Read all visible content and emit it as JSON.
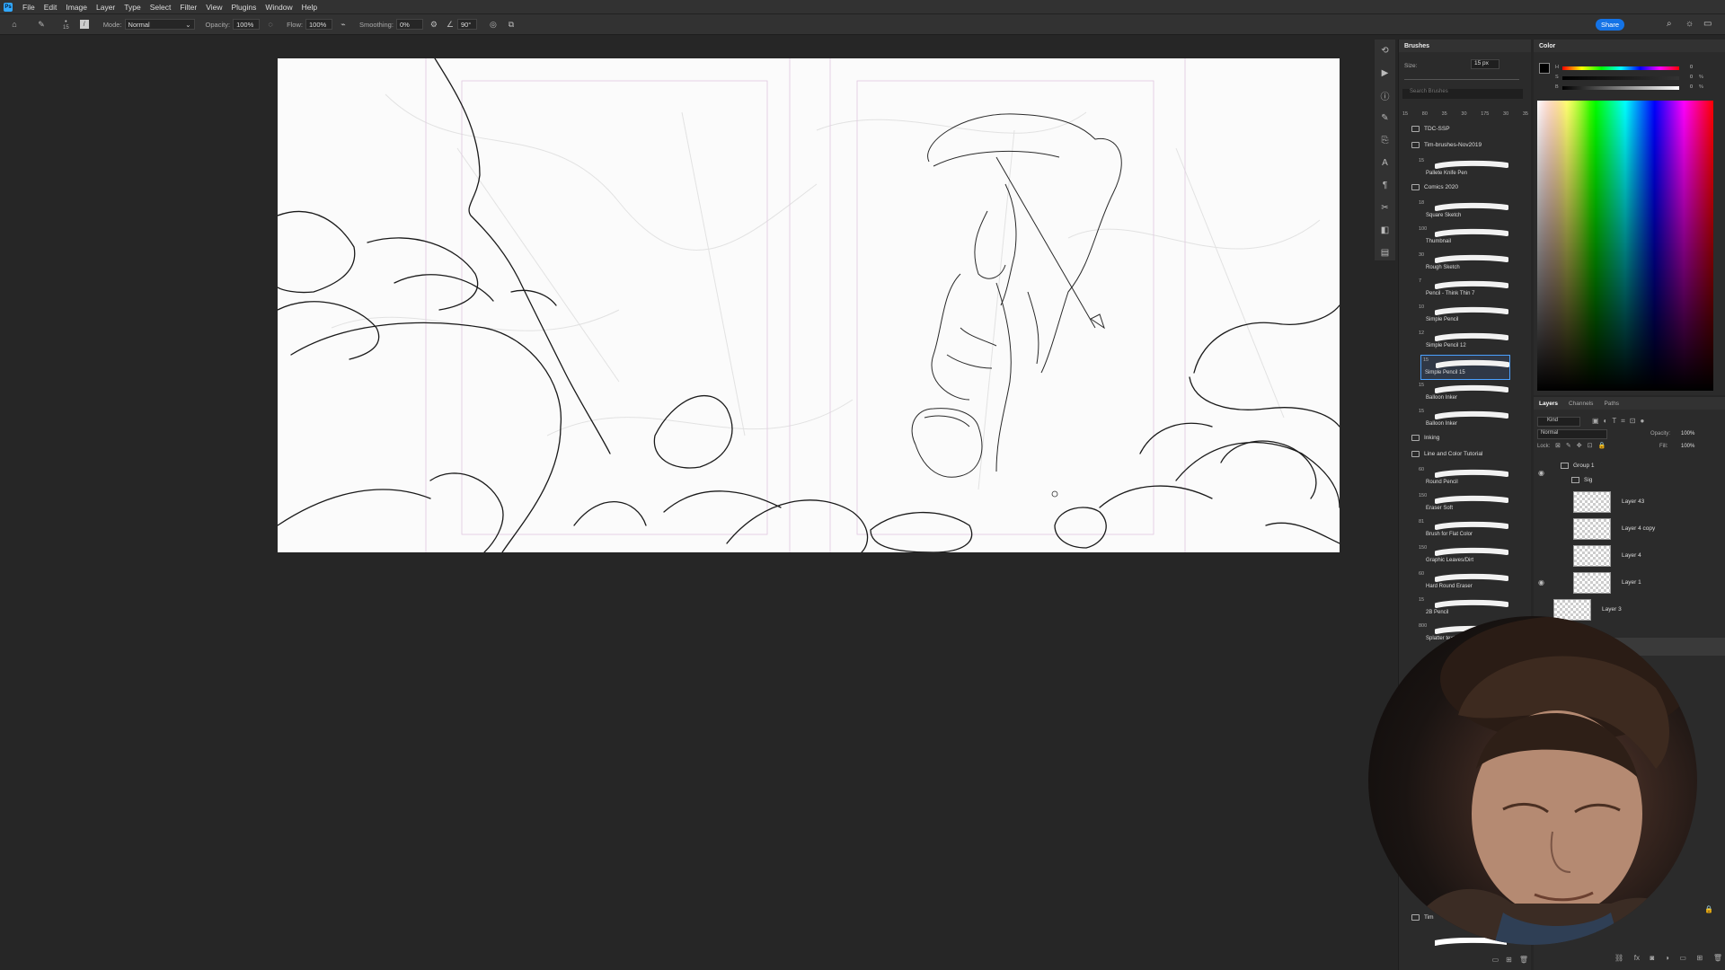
{
  "app": {
    "logo": "Ps",
    "menu": [
      "File",
      "Edit",
      "Image",
      "Layer",
      "Type",
      "Select",
      "Filter",
      "View",
      "Plugins",
      "Window",
      "Help"
    ],
    "share_label": "Share"
  },
  "options": {
    "brush_size": "15",
    "mode_label": "Mode:",
    "mode_value": "Normal",
    "opacity_label": "Opacity:",
    "opacity_value": "100%",
    "flow_label": "Flow:",
    "flow_value": "100%",
    "smoothing_label": "Smoothing:",
    "smoothing_value": "0%",
    "angle_value": "90°"
  },
  "brushes": {
    "title": "Brushes",
    "size_label": "Size:",
    "size_value": "15 px",
    "search_placeholder": "Search Brushes",
    "presets": [
      "15",
      "80",
      "35",
      "30",
      "175",
      "30",
      "35"
    ],
    "items": [
      {
        "type": "folder",
        "label": "TDC-SSP"
      },
      {
        "type": "folder",
        "label": "Tim-brushes-Nov2019"
      },
      {
        "type": "brush",
        "label": "Pallete Knife Pen",
        "size": "15"
      },
      {
        "type": "folder",
        "label": "Comics 2020"
      },
      {
        "type": "brush",
        "label": "Square Sketch",
        "size": "18"
      },
      {
        "type": "brush",
        "label": "Thumbnail",
        "size": "100"
      },
      {
        "type": "brush",
        "label": "Rough Sketch",
        "size": "30"
      },
      {
        "type": "brush",
        "label": "Pencil - Think Thin 7",
        "size": "7"
      },
      {
        "type": "brush",
        "label": "Simple Pencil",
        "size": "10"
      },
      {
        "type": "brush",
        "label": "Simple Pencil 12",
        "size": "12"
      },
      {
        "type": "brush",
        "label": "Simple Pencil 15",
        "size": "15",
        "selected": true
      },
      {
        "type": "brush",
        "label": "Balloon Inker",
        "size": "15"
      },
      {
        "type": "brush",
        "label": "Balloon Inker",
        "size": "15"
      },
      {
        "type": "folder",
        "label": "Inking"
      },
      {
        "type": "folder",
        "label": "Line and Color Tutorial"
      },
      {
        "type": "brush",
        "label": "Round Pencil",
        "size": "60"
      },
      {
        "type": "brush",
        "label": "Eraser Soft",
        "size": "150"
      },
      {
        "type": "brush",
        "label": "Brush for Flat Color",
        "size": "81"
      },
      {
        "type": "brush",
        "label": "Graphic Leaves/Dirt",
        "size": "150"
      },
      {
        "type": "brush",
        "label": "Hard Round Eraser",
        "size": "60"
      },
      {
        "type": "brush",
        "label": "2B Pencil",
        "size": "15"
      },
      {
        "type": "brush",
        "label": "Splatter texture",
        "size": "800"
      }
    ],
    "bottom_items": [
      {
        "type": "folder",
        "label": "Tim"
      }
    ]
  },
  "color": {
    "title": "Color",
    "slider_values": [
      "0",
      "0",
      "0"
    ],
    "slider_units": [
      "",
      "%",
      "%"
    ],
    "slider_labels": [
      "H",
      "S",
      "B"
    ]
  },
  "layers": {
    "tabs": [
      "Layers",
      "Channels",
      "Paths"
    ],
    "kind_label": "Kind",
    "blend_mode": "Normal",
    "opacity_label": "Opacity:",
    "opacity_value": "100%",
    "lock_label": "Lock:",
    "fill_label": "Fill:",
    "fill_value": "100%",
    "items": [
      {
        "name": "Group 1",
        "kind": "group"
      },
      {
        "name": "Sig",
        "kind": "group"
      },
      {
        "name": "Layer 43",
        "kind": "layer"
      },
      {
        "name": "Layer 4 copy",
        "kind": "layer"
      },
      {
        "name": "Layer 4",
        "kind": "layer"
      },
      {
        "name": "Layer 1",
        "kind": "layer"
      },
      {
        "name": "Layer 3",
        "kind": "layer"
      }
    ]
  },
  "colors": {
    "accent": "#1473e6",
    "panel_bg": "#2b2b2b",
    "app_bg": "#262626"
  }
}
